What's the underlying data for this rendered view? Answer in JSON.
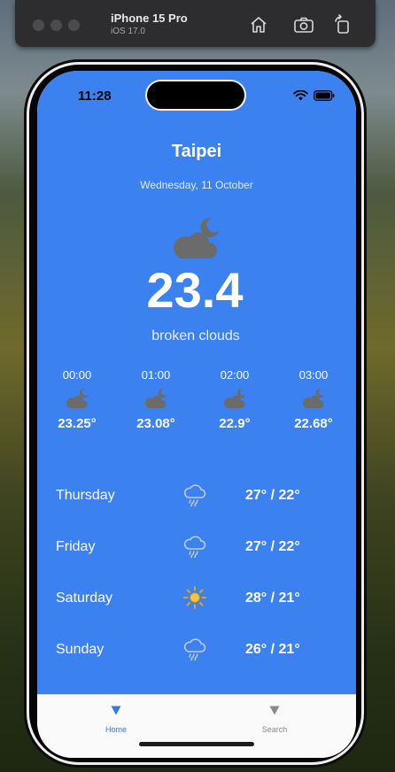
{
  "simulator": {
    "device": "iPhone 15 Pro",
    "os": "iOS 17.0",
    "buttons": [
      "home-icon",
      "screenshot-icon",
      "rotate-icon"
    ]
  },
  "status_bar": {
    "time": "11:28"
  },
  "weather": {
    "city": "Taipei",
    "date": "Wednesday, 11 October",
    "temperature": "23.4",
    "description": "broken clouds",
    "icon": "cloud-moon-icon"
  },
  "hourly": [
    {
      "time": "00:00",
      "temp": "23.25°",
      "icon": "cloud-moon-icon"
    },
    {
      "time": "01:00",
      "temp": "23.08°",
      "icon": "cloud-moon-icon"
    },
    {
      "time": "02:00",
      "temp": "22.9°",
      "icon": "cloud-moon-icon"
    },
    {
      "time": "03:00",
      "temp": "22.68°",
      "icon": "cloud-moon-icon"
    }
  ],
  "daily": [
    {
      "day": "Thursday",
      "temp": "27° / 22°",
      "icon": "rain-cloud-icon"
    },
    {
      "day": "Friday",
      "temp": "27° / 22°",
      "icon": "rain-cloud-icon"
    },
    {
      "day": "Saturday",
      "temp": "28° / 21°",
      "icon": "sun-icon"
    },
    {
      "day": "Sunday",
      "temp": "26° / 21°",
      "icon": "rain-cloud-icon"
    }
  ],
  "tabbar": {
    "tabs": [
      {
        "label": "Home",
        "active": true,
        "icon": "triangle-down-icon"
      },
      {
        "label": "Search",
        "active": false,
        "icon": "triangle-down-icon"
      }
    ]
  },
  "colors": {
    "background": "#3b82f0",
    "tab_active": "#2f7bec",
    "tab_inactive": "#8a8a8a",
    "icon_dark": "#6b6b6b"
  }
}
